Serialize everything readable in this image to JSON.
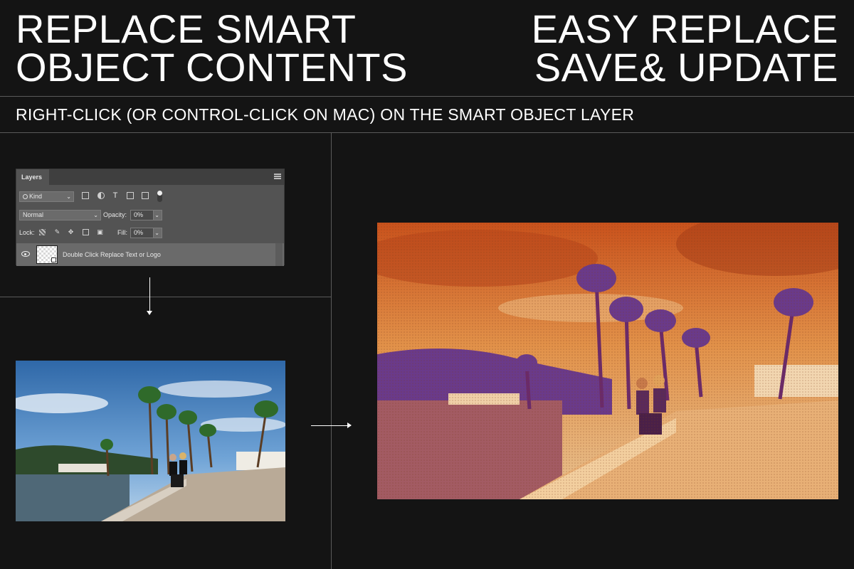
{
  "headline_left": {
    "line1": "REPLACE SMART",
    "line2": "OBJECT CONTENTS"
  },
  "headline_right": {
    "line1": "EASY REPLACE",
    "line2": "SAVE& UPDATE"
  },
  "instruction": "RIGHT-CLICK (OR CONTROL-CLICK ON MAC) ON THE SMART OBJECT LAYER",
  "layers_panel": {
    "tab": "Layers",
    "filter": {
      "value": "Kind",
      "icons": [
        "image-filter-icon",
        "adjustment-filter-icon",
        "type-filter-icon",
        "shape-filter-icon",
        "smart-object-filter-icon",
        "filter-toggle-icon"
      ]
    },
    "blend_mode": "Normal",
    "opacity_label": "Opacity:",
    "opacity_value": "0%",
    "lock_label": "Lock:",
    "lock_icons": [
      "lock-transparent-icon",
      "lock-paint-icon",
      "lock-move-icon",
      "lock-artboard-icon",
      "lock-all-icon"
    ],
    "fill_label": "Fill:",
    "fill_value": "0%",
    "layer": {
      "name": "Double Click Replace Text or Logo",
      "visible": true
    }
  },
  "colors": {
    "background": "#141414",
    "panel": "#535353",
    "result_orange": "#d86a22",
    "result_purple": "#6a3a8a",
    "sky_blue": "#4a86c4"
  }
}
